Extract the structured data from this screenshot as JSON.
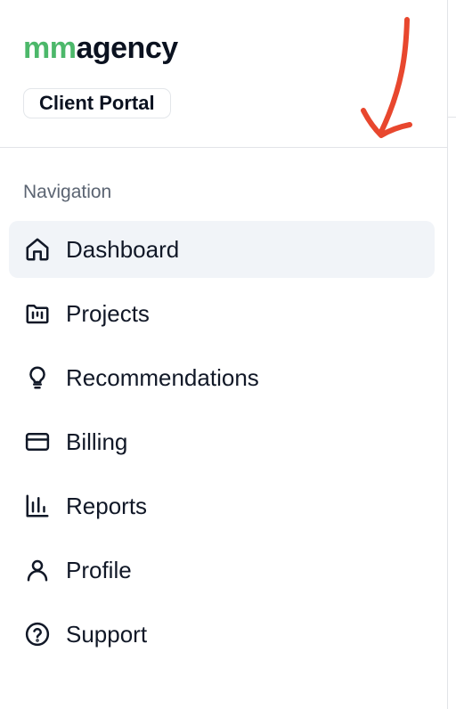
{
  "brand": {
    "part1": "mm",
    "part2": "agency",
    "accent_color": "#4cb86a"
  },
  "badge": {
    "label": "Client Portal"
  },
  "nav": {
    "section_label": "Navigation",
    "items": [
      {
        "label": "Dashboard",
        "icon": "home-icon",
        "active": true
      },
      {
        "label": "Projects",
        "icon": "folder-kanban-icon",
        "active": false
      },
      {
        "label": "Recommendations",
        "icon": "lightbulb-icon",
        "active": false
      },
      {
        "label": "Billing",
        "icon": "credit-card-icon",
        "active": false
      },
      {
        "label": "Reports",
        "icon": "bar-chart-icon",
        "active": false
      },
      {
        "label": "Profile",
        "icon": "user-icon",
        "active": false
      },
      {
        "label": "Support",
        "icon": "help-circle-icon",
        "active": false
      }
    ]
  },
  "annotation": {
    "icon": "hand-drawn-arrow-icon",
    "color": "#e8472e"
  }
}
